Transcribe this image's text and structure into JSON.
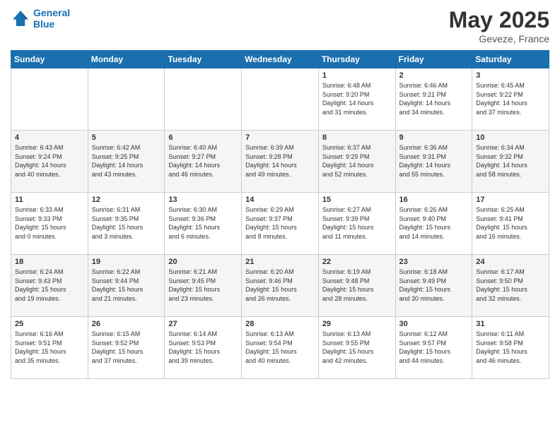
{
  "header": {
    "logo_line1": "General",
    "logo_line2": "Blue",
    "month": "May 2025",
    "location": "Geveze, France"
  },
  "days_of_week": [
    "Sunday",
    "Monday",
    "Tuesday",
    "Wednesday",
    "Thursday",
    "Friday",
    "Saturday"
  ],
  "weeks": [
    [
      {
        "num": "",
        "info": ""
      },
      {
        "num": "",
        "info": ""
      },
      {
        "num": "",
        "info": ""
      },
      {
        "num": "",
        "info": ""
      },
      {
        "num": "1",
        "info": "Sunrise: 6:48 AM\nSunset: 9:20 PM\nDaylight: 14 hours\nand 31 minutes."
      },
      {
        "num": "2",
        "info": "Sunrise: 6:46 AM\nSunset: 9:21 PM\nDaylight: 14 hours\nand 34 minutes."
      },
      {
        "num": "3",
        "info": "Sunrise: 6:45 AM\nSunset: 9:22 PM\nDaylight: 14 hours\nand 37 minutes."
      }
    ],
    [
      {
        "num": "4",
        "info": "Sunrise: 6:43 AM\nSunset: 9:24 PM\nDaylight: 14 hours\nand 40 minutes."
      },
      {
        "num": "5",
        "info": "Sunrise: 6:42 AM\nSunset: 9:25 PM\nDaylight: 14 hours\nand 43 minutes."
      },
      {
        "num": "6",
        "info": "Sunrise: 6:40 AM\nSunset: 9:27 PM\nDaylight: 14 hours\nand 46 minutes."
      },
      {
        "num": "7",
        "info": "Sunrise: 6:39 AM\nSunset: 9:28 PM\nDaylight: 14 hours\nand 49 minutes."
      },
      {
        "num": "8",
        "info": "Sunrise: 6:37 AM\nSunset: 9:29 PM\nDaylight: 14 hours\nand 52 minutes."
      },
      {
        "num": "9",
        "info": "Sunrise: 6:36 AM\nSunset: 9:31 PM\nDaylight: 14 hours\nand 55 minutes."
      },
      {
        "num": "10",
        "info": "Sunrise: 6:34 AM\nSunset: 9:32 PM\nDaylight: 14 hours\nand 58 minutes."
      }
    ],
    [
      {
        "num": "11",
        "info": "Sunrise: 6:33 AM\nSunset: 9:33 PM\nDaylight: 15 hours\nand 0 minutes."
      },
      {
        "num": "12",
        "info": "Sunrise: 6:31 AM\nSunset: 9:35 PM\nDaylight: 15 hours\nand 3 minutes."
      },
      {
        "num": "13",
        "info": "Sunrise: 6:30 AM\nSunset: 9:36 PM\nDaylight: 15 hours\nand 6 minutes."
      },
      {
        "num": "14",
        "info": "Sunrise: 6:29 AM\nSunset: 9:37 PM\nDaylight: 15 hours\nand 8 minutes."
      },
      {
        "num": "15",
        "info": "Sunrise: 6:27 AM\nSunset: 9:39 PM\nDaylight: 15 hours\nand 11 minutes."
      },
      {
        "num": "16",
        "info": "Sunrise: 6:26 AM\nSunset: 9:40 PM\nDaylight: 15 hours\nand 14 minutes."
      },
      {
        "num": "17",
        "info": "Sunrise: 6:25 AM\nSunset: 9:41 PM\nDaylight: 15 hours\nand 16 minutes."
      }
    ],
    [
      {
        "num": "18",
        "info": "Sunrise: 6:24 AM\nSunset: 9:43 PM\nDaylight: 15 hours\nand 19 minutes."
      },
      {
        "num": "19",
        "info": "Sunrise: 6:22 AM\nSunset: 9:44 PM\nDaylight: 15 hours\nand 21 minutes."
      },
      {
        "num": "20",
        "info": "Sunrise: 6:21 AM\nSunset: 9:45 PM\nDaylight: 15 hours\nand 23 minutes."
      },
      {
        "num": "21",
        "info": "Sunrise: 6:20 AM\nSunset: 9:46 PM\nDaylight: 15 hours\nand 26 minutes."
      },
      {
        "num": "22",
        "info": "Sunrise: 6:19 AM\nSunset: 9:48 PM\nDaylight: 15 hours\nand 28 minutes."
      },
      {
        "num": "23",
        "info": "Sunrise: 6:18 AM\nSunset: 9:49 PM\nDaylight: 15 hours\nand 30 minutes."
      },
      {
        "num": "24",
        "info": "Sunrise: 6:17 AM\nSunset: 9:50 PM\nDaylight: 15 hours\nand 32 minutes."
      }
    ],
    [
      {
        "num": "25",
        "info": "Sunrise: 6:16 AM\nSunset: 9:51 PM\nDaylight: 15 hours\nand 35 minutes."
      },
      {
        "num": "26",
        "info": "Sunrise: 6:15 AM\nSunset: 9:52 PM\nDaylight: 15 hours\nand 37 minutes."
      },
      {
        "num": "27",
        "info": "Sunrise: 6:14 AM\nSunset: 9:53 PM\nDaylight: 15 hours\nand 39 minutes."
      },
      {
        "num": "28",
        "info": "Sunrise: 6:13 AM\nSunset: 9:54 PM\nDaylight: 15 hours\nand 40 minutes."
      },
      {
        "num": "29",
        "info": "Sunrise: 6:13 AM\nSunset: 9:55 PM\nDaylight: 15 hours\nand 42 minutes."
      },
      {
        "num": "30",
        "info": "Sunrise: 6:12 AM\nSunset: 9:57 PM\nDaylight: 15 hours\nand 44 minutes."
      },
      {
        "num": "31",
        "info": "Sunrise: 6:11 AM\nSunset: 9:58 PM\nDaylight: 15 hours\nand 46 minutes."
      }
    ]
  ]
}
